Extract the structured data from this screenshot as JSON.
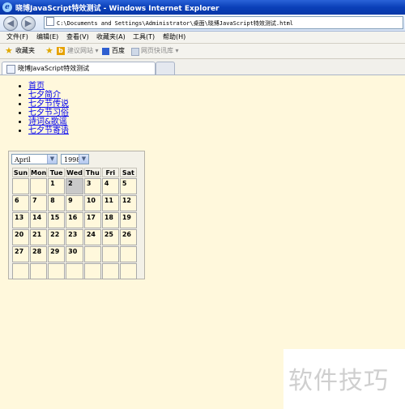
{
  "window": {
    "title": "晓博JavaScript特效测试 - Windows Internet Explorer"
  },
  "address": {
    "url": "C:\\Documents and Settings\\Administrator\\桌面\\晓博JavaScript特效测试.html"
  },
  "menu": [
    {
      "label": "文件(F)"
    },
    {
      "label": "编辑(E)"
    },
    {
      "label": "查看(V)"
    },
    {
      "label": "收藏夹(A)"
    },
    {
      "label": "工具(T)"
    },
    {
      "label": "帮助(H)"
    }
  ],
  "favorites": {
    "favorites_label": "收藏夹",
    "suggested_sites": "建议网站 ▾",
    "baidu": "百度",
    "web_slice": "网页快讯库 ▾"
  },
  "tab": {
    "label": "晓博JavaScript特效测试"
  },
  "nav_links": [
    {
      "label": "首页"
    },
    {
      "label": "七夕简介"
    },
    {
      "label": "七夕节传说"
    },
    {
      "label": "七夕节习俗"
    },
    {
      "label": "诗词&歌谣"
    },
    {
      "label": "七夕节寄语"
    }
  ],
  "calendar": {
    "month": "April",
    "year": "1998",
    "weekdays": [
      "Sun",
      "Mon",
      "Tue",
      "Wed",
      "Thu",
      "Fri",
      "Sat"
    ],
    "weeks": [
      [
        "",
        "",
        "1",
        "2",
        "3",
        "4",
        "5"
      ],
      [
        "6",
        "7",
        "8",
        "9",
        "10",
        "11",
        "12"
      ],
      [
        "13",
        "14",
        "15",
        "16",
        "17",
        "18",
        "19"
      ],
      [
        "20",
        "21",
        "22",
        "23",
        "24",
        "25",
        "26"
      ],
      [
        "27",
        "28",
        "29",
        "30",
        "",
        "",
        ""
      ],
      [
        "",
        "",
        "",
        "",
        "",
        "",
        ""
      ]
    ],
    "highlighted_day": "2",
    "highlight_color": "#c9c9c9"
  },
  "watermark": "软件技巧"
}
